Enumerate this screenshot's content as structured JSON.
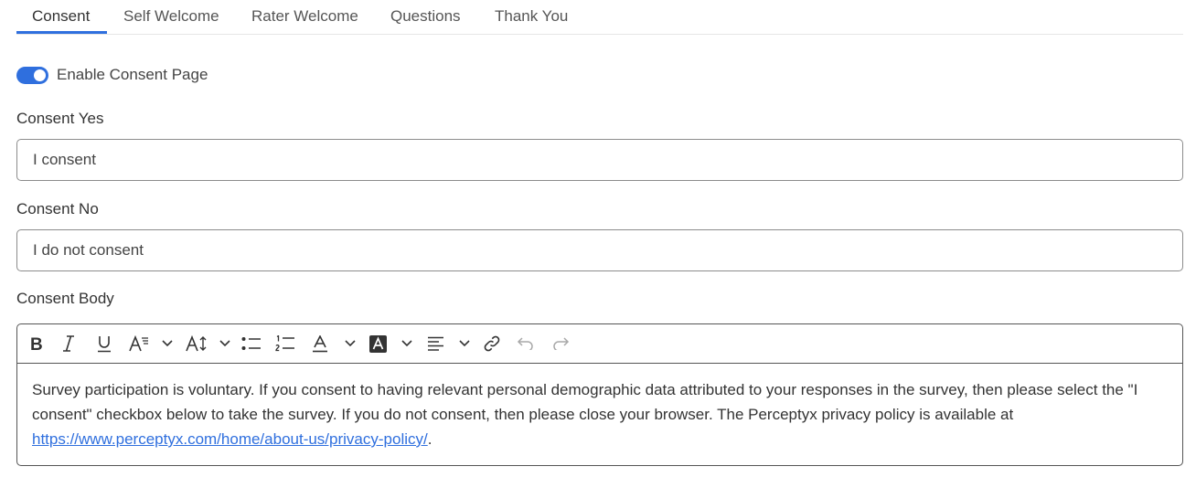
{
  "tabs": [
    {
      "label": "Consent",
      "active": true
    },
    {
      "label": "Self Welcome",
      "active": false
    },
    {
      "label": "Rater Welcome",
      "active": false
    },
    {
      "label": "Questions",
      "active": false
    },
    {
      "label": "Thank You",
      "active": false
    }
  ],
  "consent_toggle": {
    "label": "Enable Consent Page",
    "enabled": true
  },
  "consent_yes": {
    "label": "Consent Yes",
    "value": "I consent"
  },
  "consent_no": {
    "label": "Consent No",
    "value": "I do not consent"
  },
  "consent_body": {
    "label": "Consent Body",
    "text": "Survey participation is voluntary. If you consent to having relevant personal demographic data attributed to your responses in the survey, then please select the \"I consent\" checkbox below to take the survey. If you do not consent, then please close your browser. The Perceptyx privacy policy is available at ",
    "link": "https://www.perceptyx.com/home/about-us/privacy-policy/",
    "suffix": "."
  },
  "toolbar_icons": [
    "bold-icon",
    "italic-icon",
    "underline-icon",
    "font-family-icon",
    "font-size-icon",
    "bulleted-list-icon",
    "numbered-list-icon",
    "text-color-icon",
    "highlight-color-icon",
    "align-icon",
    "link-icon",
    "undo-icon",
    "redo-icon"
  ],
  "colors": {
    "accent": "#2f6fde",
    "text": "#333333",
    "border": "#8c8c8c"
  }
}
